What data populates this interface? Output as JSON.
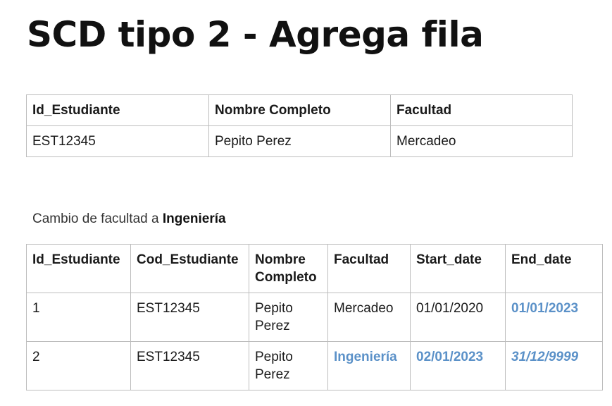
{
  "title": "SCD tipo 2 - Agrega fila",
  "table1": {
    "headers": [
      "Id_Estudiante",
      "Nombre Completo",
      "Facultad"
    ],
    "rows": [
      [
        "EST12345",
        "Pepito Perez",
        "Mercadeo"
      ]
    ]
  },
  "caption": {
    "prefix": "Cambio de facultad a ",
    "emphasis": "Ingeniería"
  },
  "table2": {
    "headers": [
      "Id_Estudiante",
      "Cod_Estudiante",
      "Nombre Completo",
      "Facultad",
      "Start_date",
      "End_date"
    ],
    "rows": [
      [
        "1",
        "EST12345",
        "Pepito Perez",
        "Mercadeo",
        "01/01/2020",
        "01/01/2023"
      ],
      [
        "2",
        "EST12345",
        "Pepito Perez",
        "Ingeniería",
        "02/01/2023",
        "31/12/9999"
      ]
    ]
  },
  "highlight_color": "#5b91c8"
}
